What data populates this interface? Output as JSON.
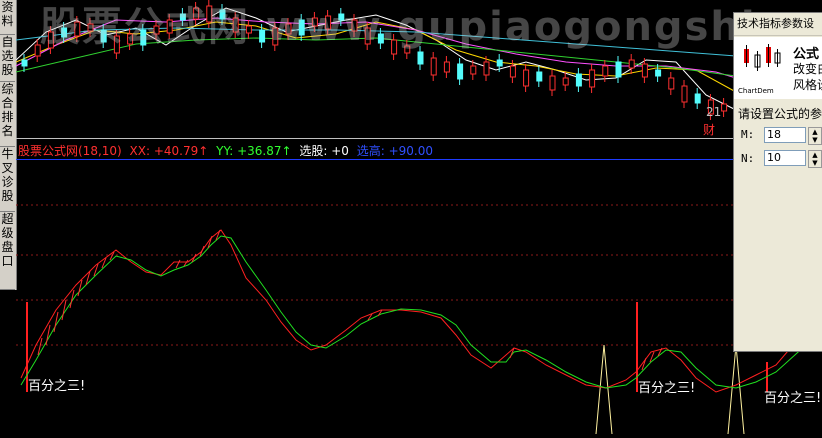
{
  "sidebar": {
    "tabs": [
      {
        "label": "资料"
      },
      {
        "label": "自选股"
      },
      {
        "label": "综合排名"
      },
      {
        "label": "牛叉诊股"
      },
      {
        "label": "超级盘口"
      }
    ]
  },
  "watermark": "股票公式网 www.gupiaogongshi.cn",
  "top_chart": {
    "price_label": "21",
    "event_marker": "财"
  },
  "indicator": {
    "name": "股票公式网(18,10)",
    "xx": "XX: +40.79↑",
    "yy": "YY: +36.87↑",
    "select": "选股: +0",
    "alert": "选高: +90.00",
    "colors": {
      "xx": "#ff3030",
      "yy": "#30ff30",
      "select": "#ffffff",
      "alert": "#3050ff",
      "name": "#ff3030"
    }
  },
  "annotations": [
    {
      "text": "百分之三!"
    },
    {
      "text": "百分之三!"
    },
    {
      "text": "百分之三!"
    }
  ],
  "dialog": {
    "title": "技术指标参数设",
    "header_title": "公式",
    "header_line2": "改变白",
    "header_line3": "风格设",
    "logo_text": "ChartDem",
    "prompt": "请设置公式的参",
    "params": [
      {
        "name": "M:",
        "value": "18"
      },
      {
        "name": "N:",
        "value": "10"
      }
    ]
  }
}
